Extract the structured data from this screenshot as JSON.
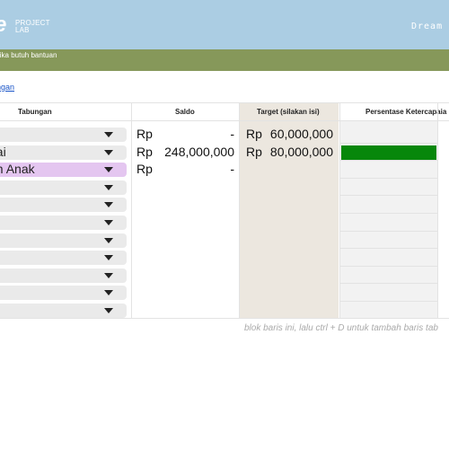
{
  "header": {
    "logo_mark": "e",
    "logo_line1": "PROJECT",
    "logo_line2": "LAB",
    "app_name": "Dream T",
    "bg_color": "#abcde3"
  },
  "helpbar": {
    "text": "jika butuh bantuan",
    "bg_color": "#86985a"
  },
  "link": {
    "text": "ngan"
  },
  "table": {
    "headers": {
      "tabungan": "Tabungan",
      "saldo": "Saldo",
      "target": "Target (silakan isi)",
      "persentase": "Persentase Ketercapaia"
    },
    "rows": [
      {
        "tabungan": "",
        "saldo_rp": "Rp",
        "saldo": "-",
        "target_rp": "Rp",
        "target": "60,000,000",
        "progress": null
      },
      {
        "tabungan": "nai",
        "saldo_rp": "Rp",
        "saldo": "248,000,000",
        "target_rp": "Rp",
        "target": "80,000,000",
        "progress": 1.0
      },
      {
        "tabungan": "an Anak",
        "saldo_rp": "Rp",
        "saldo": "-",
        "target_rp": "",
        "target": "",
        "progress": null
      },
      {
        "tabungan": "",
        "saldo_rp": "",
        "saldo": "",
        "target_rp": "",
        "target": "",
        "progress": null
      },
      {
        "tabungan": "",
        "saldo_rp": "",
        "saldo": "",
        "target_rp": "",
        "target": "",
        "progress": null
      },
      {
        "tabungan": "",
        "saldo_rp": "",
        "saldo": "",
        "target_rp": "",
        "target": "",
        "progress": null
      },
      {
        "tabungan": "",
        "saldo_rp": "",
        "saldo": "",
        "target_rp": "",
        "target": "",
        "progress": null
      },
      {
        "tabungan": "",
        "saldo_rp": "",
        "saldo": "",
        "target_rp": "",
        "target": "",
        "progress": null
      },
      {
        "tabungan": "",
        "saldo_rp": "",
        "saldo": "",
        "target_rp": "",
        "target": "",
        "progress": null
      },
      {
        "tabungan": "",
        "saldo_rp": "",
        "saldo": "",
        "target_rp": "",
        "target": "",
        "progress": null
      },
      {
        "tabungan": "",
        "saldo_rp": "",
        "saldo": "",
        "target_rp": "",
        "target": "",
        "progress": null
      }
    ],
    "target_column_color": "#ece7df",
    "progress_color": "#07870b",
    "highlight_row_color": "#e4c6f0",
    "dropdown_icon": "triangle-down-icon"
  },
  "footer_note": "blok baris ini, lalu ctrl + D untuk tambah baris tab"
}
